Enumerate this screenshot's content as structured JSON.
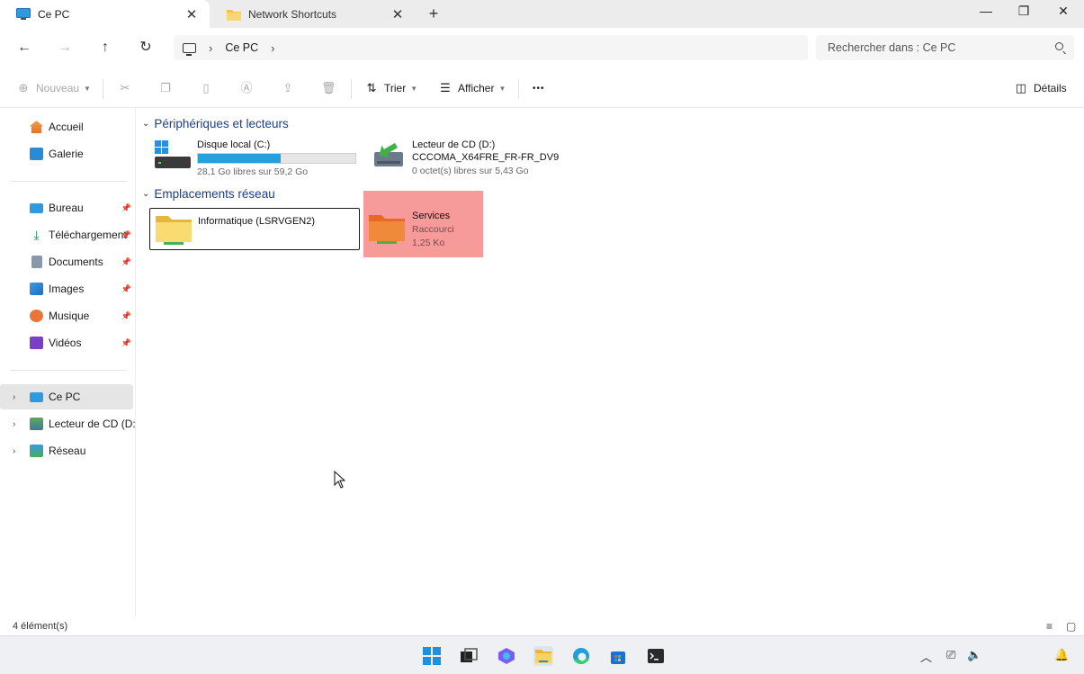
{
  "tabs": [
    {
      "label": "Ce PC",
      "active": true
    },
    {
      "label": "Network Shortcuts",
      "active": false
    }
  ],
  "address": {
    "crumbs": [
      "Ce PC"
    ],
    "search_placeholder": "Rechercher dans : Ce PC"
  },
  "toolbar": {
    "new_label": "Nouveau",
    "sort_label": "Trier",
    "view_label": "Afficher",
    "more_label": "•••",
    "details_label": "Détails"
  },
  "sidebar": {
    "quick": [
      {
        "label": "Accueil",
        "icon": "home-icon"
      },
      {
        "label": "Galerie",
        "icon": "gallery-icon"
      }
    ],
    "pinned": [
      {
        "label": "Bureau",
        "icon": "desktop-icon"
      },
      {
        "label": "Téléchargement",
        "icon": "download-icon"
      },
      {
        "label": "Documents",
        "icon": "documents-icon"
      },
      {
        "label": "Images",
        "icon": "images-icon"
      },
      {
        "label": "Musique",
        "icon": "music-icon"
      },
      {
        "label": "Vidéos",
        "icon": "videos-icon"
      }
    ],
    "tree": [
      {
        "label": "Ce PC",
        "icon": "pc-icon",
        "selected": true
      },
      {
        "label": "Lecteur de CD (D:) C",
        "icon": "cd-drive-icon"
      },
      {
        "label": "Réseau",
        "icon": "network-icon"
      }
    ]
  },
  "content": {
    "devices_header": "Périphériques et lecteurs",
    "network_header": "Emplacements réseau",
    "drive_c": {
      "name": "Disque local (C:)",
      "free": "28,1 Go libres sur 59,2 Go",
      "used_fraction": 0.525
    },
    "drive_d": {
      "name": "Lecteur de CD (D:)",
      "label": "CCCOMA_X64FRE_FR-FR_DV9",
      "free": "0 octet(s) libres sur 5,43 Go"
    },
    "net_informatique": {
      "name": "Informatique (LSRVGEN2)"
    },
    "net_services": {
      "name": "Services",
      "type": "Raccourci",
      "size": "1,25 Ko"
    }
  },
  "status": {
    "count": "4 élément(s)"
  },
  "colors": {
    "accent": "#26a0da",
    "highlight": "#f79a9a",
    "header": "#1c3e8a"
  }
}
